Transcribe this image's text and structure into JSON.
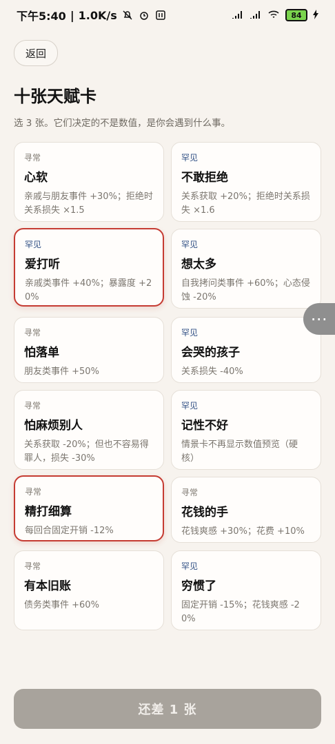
{
  "status_bar": {
    "time": "下午5:40",
    "speed": "1.0K/s",
    "battery": "84"
  },
  "header": {
    "back_label": "返回",
    "title": "十张天赋卡",
    "subtitle": "选 3 张。它们决定的不是数值，是你会遇到什么事。"
  },
  "cards": [
    {
      "rarity": "寻常",
      "title": "心软",
      "effect": "亲戚与朋友事件 +30%；拒绝时关系损失 ×1.5",
      "selected": false
    },
    {
      "rarity": "罕见",
      "title": "不敢拒绝",
      "effect": "关系获取 +20%；拒绝时关系损失 ×1.6",
      "selected": false
    },
    {
      "rarity": "罕见",
      "title": "爱打听",
      "effect": "亲戚类事件 +40%；暴露度 +20%",
      "selected": true
    },
    {
      "rarity": "罕见",
      "title": "想太多",
      "effect": "自我拷问类事件 +60%；心态侵蚀 -20%",
      "selected": false
    },
    {
      "rarity": "寻常",
      "title": "怕落单",
      "effect": "朋友类事件 +50%",
      "selected": false
    },
    {
      "rarity": "罕见",
      "title": "会哭的孩子",
      "effect": "关系损失 -40%",
      "selected": false
    },
    {
      "rarity": "寻常",
      "title": "怕麻烦别人",
      "effect": "关系获取 -20%；但也不容易得罪人，损失 -30%",
      "selected": false
    },
    {
      "rarity": "罕见",
      "title": "记性不好",
      "effect": "情景卡不再显示数值预览（硬核）",
      "selected": false
    },
    {
      "rarity": "寻常",
      "title": "精打细算",
      "effect": "每回合固定开销 -12%",
      "selected": true
    },
    {
      "rarity": "寻常",
      "title": "花钱的手",
      "effect": "花钱爽感 +30%；花费 +10%",
      "selected": false
    },
    {
      "rarity": "寻常",
      "title": "有本旧账",
      "effect": "债务类事件 +60%",
      "selected": false
    },
    {
      "rarity": "罕见",
      "title": "穷惯了",
      "effect": "固定开销 -15%；花钱爽感 -20%",
      "selected": false
    }
  ],
  "bottom_button": {
    "label": "还差 1 张"
  },
  "colors": {
    "background": "#f7f3ee",
    "card_bg": "#fffdfb",
    "selected_border": "#c53b32",
    "rare_text": "#2f4f84",
    "button_disabled": "#a8a39c"
  },
  "icons": {
    "mute": "bell-off-icon",
    "alarm": "alarm-icon",
    "nfc": "nfc-icon",
    "signal": "signal-icon",
    "wifi": "wifi-icon",
    "charging": "charging-icon",
    "more": "more-icon"
  }
}
